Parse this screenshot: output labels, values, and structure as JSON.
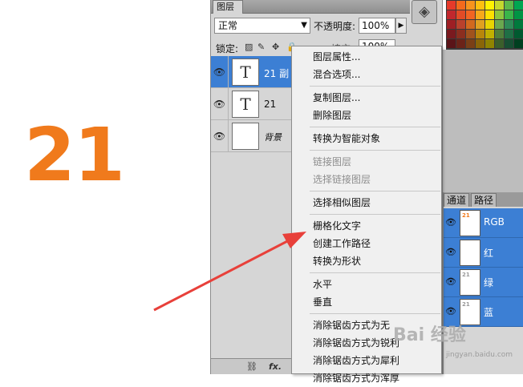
{
  "canvas": {
    "number": "21",
    "number_color": "#f07a1c"
  },
  "layers_panel": {
    "tab_label": "图层",
    "menu_icon": "▸▸ ≡",
    "blend_mode": "正常",
    "opacity_label": "不透明度:",
    "opacity_value": "100%",
    "lock_label": "锁定:",
    "fill_label": "填充:",
    "fill_value": "100%",
    "layers": [
      {
        "name": "21 副",
        "thumb": "T",
        "selected": true
      },
      {
        "name": "21",
        "thumb": "T",
        "selected": false
      },
      {
        "name": "背景",
        "thumb": "",
        "selected": false
      }
    ],
    "footer_icons": [
      "link-icon",
      "fx-icon"
    ],
    "footer_fx": "fx."
  },
  "context_menu": {
    "groups": [
      [
        {
          "label": "图层属性...",
          "enabled": true
        },
        {
          "label": "混合选项...",
          "enabled": true
        }
      ],
      [
        {
          "label": "复制图层...",
          "enabled": true
        },
        {
          "label": "删除图层",
          "enabled": true
        }
      ],
      [
        {
          "label": "转换为智能对象",
          "enabled": true
        }
      ],
      [
        {
          "label": "链接图层",
          "enabled": false
        },
        {
          "label": "选择链接图层",
          "enabled": false
        }
      ],
      [
        {
          "label": "选择相似图层",
          "enabled": true
        }
      ],
      [
        {
          "label": "栅格化文字",
          "enabled": true
        },
        {
          "label": "创建工作路径",
          "enabled": true
        },
        {
          "label": "转换为形状",
          "enabled": true
        }
      ],
      [
        {
          "label": "水平",
          "enabled": true
        },
        {
          "label": "垂直",
          "enabled": true
        }
      ],
      [
        {
          "label": "消除锯齿方式为无",
          "enabled": true
        },
        {
          "label": "消除锯齿方式为锐利",
          "enabled": true
        },
        {
          "label": "消除锯齿方式为犀利",
          "enabled": true
        },
        {
          "label": "消除锯齿方式为浑厚",
          "enabled": true
        }
      ]
    ]
  },
  "channels_panel": {
    "tabs": [
      "通道",
      "路径"
    ],
    "channels": [
      {
        "name": "RGB",
        "thumb": "21"
      },
      {
        "name": "红",
        "thumb": ""
      },
      {
        "name": "绿",
        "thumb": "21"
      },
      {
        "name": "蓝",
        "thumb": "21"
      }
    ]
  },
  "swatches": [
    "#e63a2a",
    "#f46a1c",
    "#f7941d",
    "#fdc010",
    "#fff200",
    "#c4d82e",
    "#5cb84a",
    "#00a651",
    "#c1272d",
    "#e24b26",
    "#f26522",
    "#f7a81b",
    "#fee000",
    "#8dc63f",
    "#39b54a",
    "#009444",
    "#9e1f24",
    "#b9412c",
    "#d2691e",
    "#e0a020",
    "#e8d400",
    "#6aa84f",
    "#2e8b57",
    "#007a3d",
    "#7a1a1f",
    "#8b2e1f",
    "#a0521d",
    "#b8860b",
    "#c0b000",
    "#4f7f3a",
    "#1f6f45",
    "#005a30",
    "#5a1418",
    "#6b2318",
    "#7a3f16",
    "#8a6508",
    "#908400",
    "#3b5f2b",
    "#174f33",
    "#004020"
  ],
  "annotation": {
    "arrow_color": "#e8403a"
  },
  "watermark": {
    "text": "Bai 经验",
    "sub": "jingyan.baidu.com"
  }
}
